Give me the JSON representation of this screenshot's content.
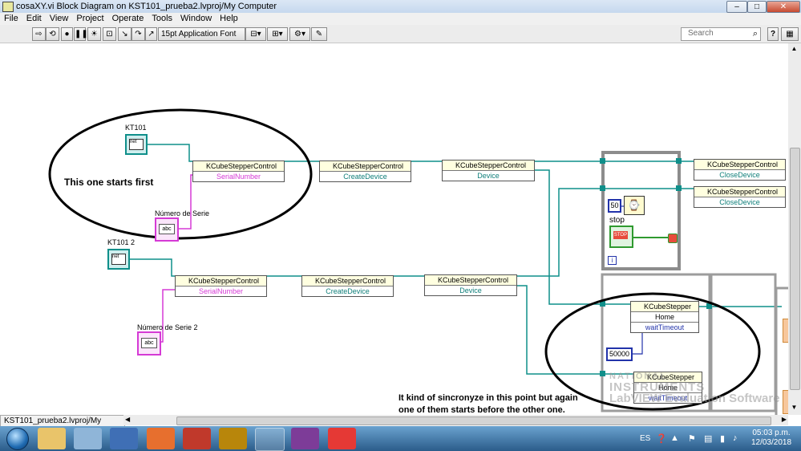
{
  "window": {
    "title": "cosaXY.vi Block Diagram on KST101_prueba2.lvproj/My Computer",
    "minimize": "–",
    "maximize": "□",
    "close": "✕"
  },
  "menu": [
    "File",
    "Edit",
    "View",
    "Project",
    "Operate",
    "Tools",
    "Window",
    "Help"
  ],
  "toolbar": {
    "font": "15pt Application Font",
    "search_placeholder": "Search",
    "help": "?"
  },
  "diagram": {
    "labels": {
      "kt101": "KT101",
      "kt101_2": "KT101 2",
      "serie": "Número de Serie",
      "serie2": "Número de Serie 2",
      "stop": "stop"
    },
    "ref_text": "net",
    "str_text": "abc",
    "nodes": {
      "class_name": "KCubeStepperControl",
      "stepper": "KCubeStepper",
      "serial": "SerialNumber",
      "create": "CreateDevice",
      "device": "Device",
      "close": "CloseDevice",
      "home": "Home",
      "wait": "waitTimeout"
    },
    "constants": {
      "wait_ms": "50",
      "timeout": "50000",
      "iteration": "i"
    },
    "stop_button": "STOP",
    "annotations": {
      "first": "This one starts first",
      "sync_line1": "It kind of sincronyze in this point but again",
      "sync_line2": "one of them starts before the other one."
    },
    "watermark": {
      "line1": "NATIONAL",
      "line2": "INSTRUMENTS",
      "line3": "LabVIEW Evaluation Software"
    }
  },
  "status_bar": "KST101_prueba2.lvproj/My Computer",
  "taskbar": {
    "language": "ES",
    "time": "05:03 p.m.",
    "date": "12/03/2018"
  },
  "colors": {
    "wire_refnum": "#0f8f8a",
    "wire_string": "#d53ad5",
    "wire_number": "#2233aa",
    "node_header": "#ffffe0"
  }
}
